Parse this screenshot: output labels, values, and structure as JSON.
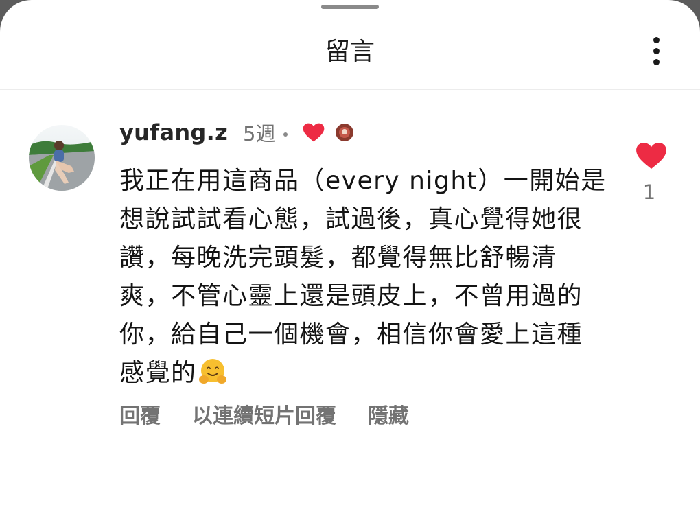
{
  "header": {
    "title": "留言",
    "more_icon": "more-vertical-icon"
  },
  "comment": {
    "username": "yufang.z",
    "time_ago": "5週",
    "creator_liked_icon": "heart-filled-icon",
    "text": "我正在用這商品（every night）一開始是想說試試看心態，試過後，真心覺得她很讚，每晚洗完頭髮，都覺得無比舒暢清爽，不管心靈上還是頭皮上，不曾用過的你，給自己一個機會，相信你會愛上這種感覺的",
    "trailing_emoji": "hugging-face-emoji",
    "actions": [
      "回覆",
      "以連續短片回覆",
      "隱藏"
    ],
    "like_count": "1",
    "like_icon": "heart-filled-icon"
  },
  "colors": {
    "heart": "#ed2b44",
    "secondary_text": "#737373",
    "primary_text": "#141414"
  }
}
